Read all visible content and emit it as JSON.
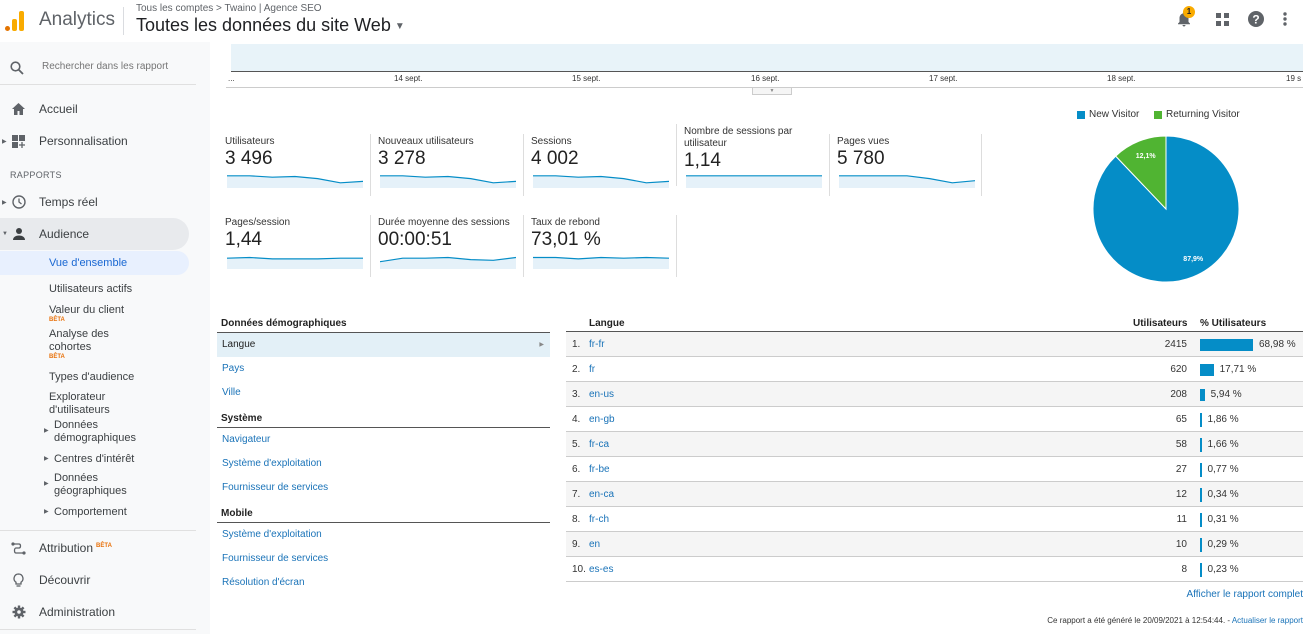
{
  "header": {
    "app_name": "Analytics",
    "breadcrumb": "Tous les comptes > Twaino | Agence SEO",
    "view_title": "Toutes les données du site Web",
    "notification_count": "1"
  },
  "sidebar": {
    "search_placeholder": "Rechercher dans les rapport",
    "items": {
      "home": "Accueil",
      "custom": "Personnalisation",
      "reports_label": "RAPPORTS",
      "realtime": "Temps réel",
      "audience": "Audience",
      "attribution": "Attribution",
      "discover": "Découvrir",
      "admin": "Administration"
    },
    "beta_label": "BÊTA",
    "audience_sub": [
      {
        "label": "Vue d'ensemble",
        "active": true
      },
      {
        "label": "Utilisateurs actifs"
      },
      {
        "label": "Valeur du client",
        "beta": true
      },
      {
        "label": "Analyse des cohortes",
        "beta": true
      },
      {
        "label": "Types d'audience"
      },
      {
        "label": "Explorateur d'utilisateurs"
      },
      {
        "label": "Données démographiques",
        "expandable": true
      },
      {
        "label": "Centres d'intérêt",
        "expandable": true
      },
      {
        "label": "Données géographiques",
        "expandable": true
      },
      {
        "label": "Comportement",
        "expandable": true
      }
    ]
  },
  "timeline": {
    "ticks": [
      "...",
      "14 sept.",
      "15 sept.",
      "16 sept.",
      "17 sept.",
      "18 sept.",
      "19 s"
    ]
  },
  "metrics": [
    {
      "label": "Utilisateurs",
      "value": "3 496",
      "trend": [
        0.8,
        0.8,
        0.7,
        0.75,
        0.6,
        0.3,
        0.4
      ]
    },
    {
      "label": "Nouveaux utilisateurs",
      "value": "3 278",
      "trend": [
        0.8,
        0.8,
        0.7,
        0.75,
        0.6,
        0.3,
        0.4
      ]
    },
    {
      "label": "Sessions",
      "value": "4 002",
      "trend": [
        0.8,
        0.8,
        0.7,
        0.75,
        0.6,
        0.3,
        0.4
      ]
    },
    {
      "label": "Nombre de sessions par utilisateur",
      "value": "1,14",
      "trend": [
        0.8,
        0.8,
        0.8,
        0.8,
        0.8,
        0.8,
        0.8
      ]
    },
    {
      "label": "Pages vues",
      "value": "5 780",
      "trend": [
        0.8,
        0.8,
        0.8,
        0.8,
        0.6,
        0.3,
        0.45
      ]
    },
    {
      "label": "Pages/session",
      "value": "1,44",
      "trend": [
        0.7,
        0.75,
        0.65,
        0.65,
        0.65,
        0.7,
        0.7
      ]
    },
    {
      "label": "Durée moyenne des sessions",
      "value": "00:00:51",
      "trend": [
        0.45,
        0.7,
        0.7,
        0.75,
        0.6,
        0.55,
        0.75
      ]
    },
    {
      "label": "Taux de rebond",
      "value": "73,01 %",
      "trend": [
        0.75,
        0.75,
        0.65,
        0.75,
        0.7,
        0.75,
        0.7
      ]
    }
  ],
  "chart_data": {
    "type": "pie",
    "title": "",
    "legend_position": "top",
    "slices": [
      {
        "label": "New Visitor",
        "value": 87.9,
        "display": "87,9%",
        "color": "#058dc7"
      },
      {
        "label": "Returning Visitor",
        "value": 12.1,
        "display": "12,1%",
        "color": "#50b432"
      }
    ]
  },
  "demographics": {
    "sections": [
      {
        "title": "Données démographiques",
        "links": [
          {
            "label": "Langue",
            "selected": true
          },
          {
            "label": "Pays"
          },
          {
            "label": "Ville"
          }
        ]
      },
      {
        "title": "Système",
        "links": [
          {
            "label": "Navigateur"
          },
          {
            "label": "Système d'exploitation"
          },
          {
            "label": "Fournisseur de services"
          }
        ]
      },
      {
        "title": "Mobile",
        "links": [
          {
            "label": "Système d'exploitation"
          },
          {
            "label": "Fournisseur de services"
          },
          {
            "label": "Résolution d'écran"
          }
        ]
      }
    ]
  },
  "table": {
    "headers": {
      "dimension": "Langue",
      "users": "Utilisateurs",
      "pct": "% Utilisateurs"
    },
    "rows": [
      {
        "rank": "1.",
        "lang": "fr-fr",
        "users": "2415",
        "pct": 68.98,
        "pct_label": "68,98 %"
      },
      {
        "rank": "2.",
        "lang": "fr",
        "users": "620",
        "pct": 17.71,
        "pct_label": "17,71 %"
      },
      {
        "rank": "3.",
        "lang": "en-us",
        "users": "208",
        "pct": 5.94,
        "pct_label": "5,94 %"
      },
      {
        "rank": "4.",
        "lang": "en-gb",
        "users": "65",
        "pct": 1.86,
        "pct_label": "1,86 %"
      },
      {
        "rank": "5.",
        "lang": "fr-ca",
        "users": "58",
        "pct": 1.66,
        "pct_label": "1,66 %"
      },
      {
        "rank": "6.",
        "lang": "fr-be",
        "users": "27",
        "pct": 0.77,
        "pct_label": "0,77 %"
      },
      {
        "rank": "7.",
        "lang": "en-ca",
        "users": "12",
        "pct": 0.34,
        "pct_label": "0,34 %"
      },
      {
        "rank": "8.",
        "lang": "fr-ch",
        "users": "11",
        "pct": 0.31,
        "pct_label": "0,31 %"
      },
      {
        "rank": "9.",
        "lang": "en",
        "users": "10",
        "pct": 0.29,
        "pct_label": "0,29 %"
      },
      {
        "rank": "10.",
        "lang": "es-es",
        "users": "8",
        "pct": 0.23,
        "pct_label": "0,23 %"
      }
    ],
    "full_report_link": "Afficher le rapport complet"
  },
  "footer": {
    "generated_text": "Ce rapport a été généré le 20/09/2021 à 12:54:44. - ",
    "refresh_link": "Actualiser le rapport"
  },
  "colors": {
    "accent": "#058dc7",
    "returning": "#50b432",
    "link": "#1a73b8",
    "beta": "#e8710a",
    "badge": "#f9ab00"
  }
}
